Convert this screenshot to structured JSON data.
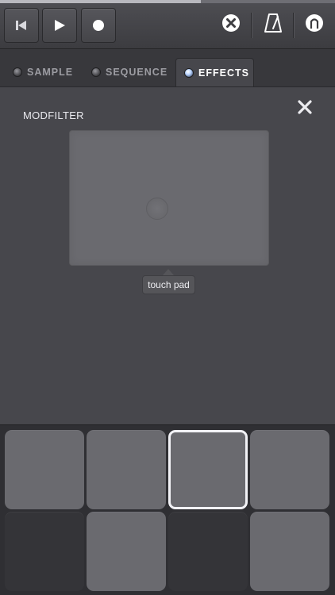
{
  "status": {
    "progress": 0.6
  },
  "toolbar": {
    "buttons": [
      {
        "name": "rewind",
        "icon": "skip-back-icon"
      },
      {
        "name": "play",
        "icon": "play-icon"
      },
      {
        "name": "record",
        "icon": "record-icon"
      }
    ],
    "right_icons": [
      "clear-circle-x-icon",
      "metronome-icon",
      "knob-icon"
    ]
  },
  "tabs": [
    {
      "label": "SAMPLE",
      "active": false
    },
    {
      "label": "SEQUENCE",
      "active": false
    },
    {
      "label": "EFFECTS",
      "active": true
    }
  ],
  "effects": {
    "title": "MODFILTER",
    "touchpad_tooltip": "touch pad"
  },
  "pads": [
    {
      "state": "normal"
    },
    {
      "state": "normal"
    },
    {
      "state": "selected"
    },
    {
      "state": "normal"
    },
    {
      "state": "dark"
    },
    {
      "state": "normal"
    },
    {
      "state": "dark"
    },
    {
      "state": "normal"
    }
  ],
  "colors": {
    "background": "#3a3a3e",
    "panel": "#47474c",
    "pad": "#6a6a6f",
    "pad_dark": "#343438",
    "accent_white": "#ffffff"
  }
}
